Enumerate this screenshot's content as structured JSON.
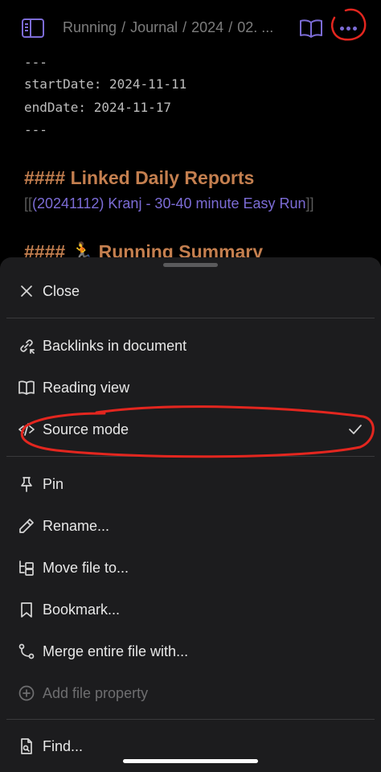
{
  "header": {
    "breadcrumb": [
      "Running",
      "Journal",
      "2024",
      "02. ..."
    ]
  },
  "editor": {
    "frontmatter_open": "---",
    "start_date_line": "startDate: 2024-11-11",
    "end_date_line": "endDate: 2024-11-17",
    "frontmatter_close": "---",
    "heading1_hashes": "####",
    "heading1_text": "Linked Daily Reports",
    "link_open": "[[",
    "link_text": "(20241112) Kranj - 30-40 minute Easy Run",
    "link_close": "]]",
    "heading2_hashes": "####",
    "heading2_text": "🏃 Running Summary"
  },
  "menu": {
    "close": "Close",
    "backlinks": "Backlinks in document",
    "reading_view": "Reading view",
    "source_mode": "Source mode",
    "pin": "Pin",
    "rename": "Rename...",
    "move_file": "Move file to...",
    "bookmark": "Bookmark...",
    "merge": "Merge entire file with...",
    "add_property": "Add file property",
    "find": "Find..."
  },
  "colors": {
    "accent": "#7c6cd6",
    "heading": "#c47f4f",
    "sheet_bg": "#1c1c1e",
    "annotation": "#e3261f"
  },
  "icons": {
    "sidebar": "sidebar-toggle-icon",
    "reading": "book-open-icon",
    "more": "more-horizontal-icon"
  }
}
